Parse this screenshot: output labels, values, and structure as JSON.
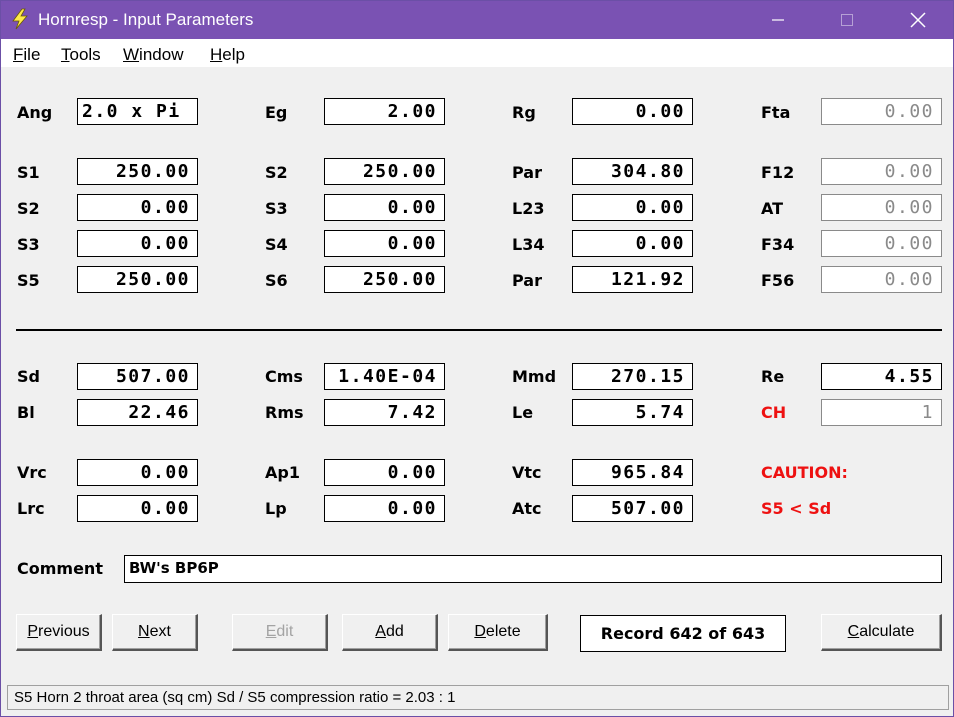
{
  "window": {
    "title": "Hornresp - Input Parameters",
    "accent": "#7a52b3"
  },
  "menu": [
    {
      "key": "F",
      "rest": "ile"
    },
    {
      "key": "T",
      "rest": "ools"
    },
    {
      "key": "W",
      "rest": "indow"
    },
    {
      "key": "H",
      "rest": "elp"
    }
  ],
  "params": {
    "ang": {
      "label": "Ang",
      "value": "2.0 x Pi"
    },
    "eg": {
      "label": "Eg",
      "value": "2.00"
    },
    "rg": {
      "label": "Rg",
      "value": "0.00"
    },
    "fta": {
      "label": "Fta",
      "value": "0.00"
    },
    "s1": {
      "label": "S1",
      "value": "250.00"
    },
    "s2a": {
      "label": "S2",
      "value": "250.00"
    },
    "par1": {
      "label": "Par",
      "value": "304.80"
    },
    "f12": {
      "label": "F12",
      "value": "0.00"
    },
    "s2b": {
      "label": "S2",
      "value": "0.00"
    },
    "s3a": {
      "label": "S3",
      "value": "0.00"
    },
    "l23": {
      "label": "L23",
      "value": "0.00"
    },
    "at": {
      "label": "AT",
      "value": "0.00"
    },
    "s3b": {
      "label": "S3",
      "value": "0.00"
    },
    "s4": {
      "label": "S4",
      "value": "0.00"
    },
    "l34": {
      "label": "L34",
      "value": "0.00"
    },
    "f34": {
      "label": "F34",
      "value": "0.00"
    },
    "s5": {
      "label": "S5",
      "value": "250.00"
    },
    "s6": {
      "label": "S6",
      "value": "250.00"
    },
    "par2": {
      "label": "Par",
      "value": "121.92"
    },
    "f56": {
      "label": "F56",
      "value": "0.00"
    },
    "sd": {
      "label": "Sd",
      "value": "507.00"
    },
    "cms": {
      "label": "Cms",
      "value": "1.40E-04"
    },
    "mmd": {
      "label": "Mmd",
      "value": "270.15"
    },
    "re": {
      "label": "Re",
      "value": "4.55"
    },
    "bl": {
      "label": "Bl",
      "value": "22.46"
    },
    "rms": {
      "label": "Rms",
      "value": "7.42"
    },
    "le": {
      "label": "Le",
      "value": "5.74"
    },
    "ch": {
      "label": "CH",
      "value": "1"
    },
    "vrc": {
      "label": "Vrc",
      "value": "0.00"
    },
    "ap1": {
      "label": "Ap1",
      "value": "0.00"
    },
    "vtc": {
      "label": "Vtc",
      "value": "965.84"
    },
    "lrc": {
      "label": "Lrc",
      "value": "0.00"
    },
    "lp": {
      "label": "Lp",
      "value": "0.00"
    },
    "atc": {
      "label": "Atc",
      "value": "507.00"
    }
  },
  "caution": {
    "title": "CAUTION:",
    "message": "S5 < Sd",
    "color": "#ee1111"
  },
  "comment": {
    "label": "Comment",
    "value": "BW's BP6P"
  },
  "buttons": {
    "previous": {
      "key": "P",
      "rest": "revious"
    },
    "next": {
      "key": "N",
      "rest": "ext"
    },
    "edit": {
      "key": "E",
      "rest": "dit"
    },
    "add": {
      "key": "A",
      "rest": "dd"
    },
    "delete": {
      "key": "D",
      "rest": "elete"
    },
    "calculate": {
      "key": "C",
      "rest": "alculate"
    }
  },
  "record": "Record 642 of 643",
  "status": "S5   Horn 2 throat area  (sq cm)   Sd / S5 compression ratio = 2.03 : 1"
}
